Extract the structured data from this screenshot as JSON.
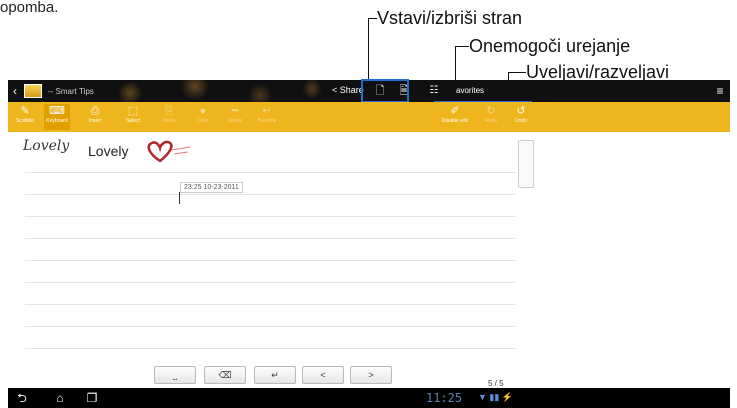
{
  "page_caption": "opomba.",
  "callouts": {
    "insert_delete": "Vstavi/izbriši stran",
    "disable_editing": "Onemogoči urejanje",
    "undo_redo": "Uveljavi/razveljavi"
  },
  "titlebar": {
    "back_glyph": "‹",
    "title": "-- Smart Tips",
    "share": "Share",
    "favorites": "avorites",
    "menu_glyph": "≡"
  },
  "toolbar": {
    "items": [
      {
        "label": "Scribble",
        "glyph": "✎"
      },
      {
        "label": "Keyboard",
        "glyph": "⌨"
      },
      {
        "label": "Insert",
        "glyph": "⎙"
      },
      {
        "label": "Select",
        "glyph": "⬚"
      },
      {
        "label": "Paste",
        "glyph": "⎘"
      },
      {
        "label": "Color",
        "glyph": "●"
      },
      {
        "label": "Stroke",
        "glyph": "━"
      },
      {
        "label": "Backline",
        "glyph": "↵"
      }
    ],
    "disable_edit": {
      "label": "Disable edit",
      "glyph": "✐"
    },
    "redo": {
      "label": "Redo",
      "glyph": "↻"
    },
    "undo": {
      "label": "Undo",
      "glyph": "↺"
    }
  },
  "note": {
    "handwriting": "Lovely",
    "typed_text": "Lovely",
    "timestamp": "23:25 10-23-2011"
  },
  "keys": {
    "space": "⎵",
    "backspace": "⌫",
    "enter": "↵",
    "prev": "<",
    "next": ">"
  },
  "pager": "5 / 5",
  "system_bar": {
    "back": "⮌",
    "home": "⌂",
    "recents": "❐",
    "time": "11:25",
    "status_icons": "▼ ▮▮ ⚡"
  }
}
